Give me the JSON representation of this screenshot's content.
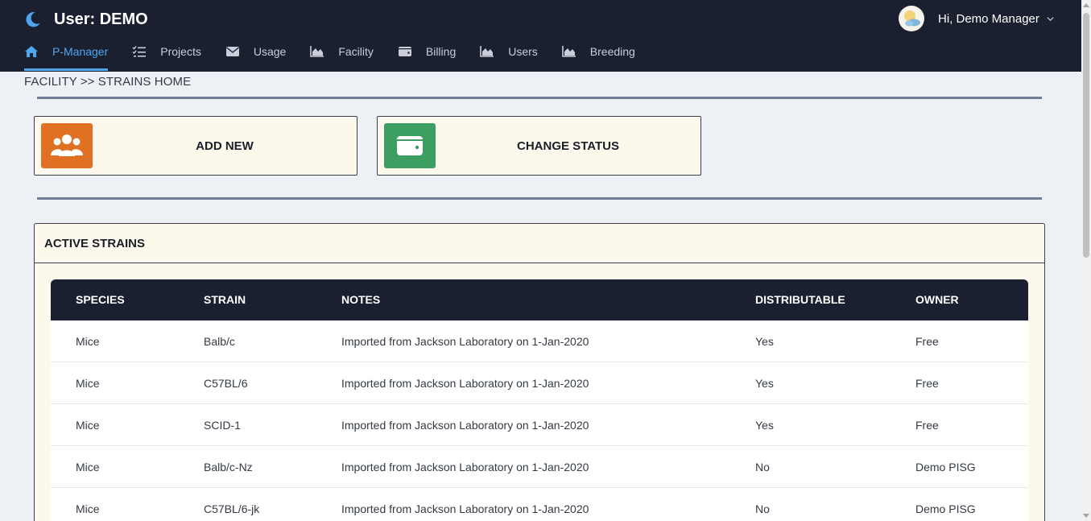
{
  "header": {
    "title": "User: DEMO",
    "greeting": "Hi, Demo Manager"
  },
  "nav": [
    {
      "label": "P-Manager",
      "icon": "home-icon",
      "active": true
    },
    {
      "label": "Projects",
      "icon": "checklist-icon"
    },
    {
      "label": "Usage",
      "icon": "envelope-icon"
    },
    {
      "label": "Facility",
      "icon": "area-chart-icon"
    },
    {
      "label": "Billing",
      "icon": "wallet-icon"
    },
    {
      "label": "Users",
      "icon": "area-chart-icon"
    },
    {
      "label": "Breeding",
      "icon": "area-chart-icon"
    }
  ],
  "breadcrumb": "FACILITY >> STRAINS HOME",
  "actions": {
    "add_new": "ADD NEW",
    "change_status": "CHANGE STATUS"
  },
  "panel": {
    "title": "ACTIVE STRAINS",
    "columns": [
      "SPECIES",
      "STRAIN",
      "NOTES",
      "DISTRIBUTABLE",
      "OWNER"
    ],
    "rows": [
      [
        "Mice",
        "Balb/c",
        "Imported from Jackson Laboratory on 1-Jan-2020",
        "Yes",
        "Free"
      ],
      [
        "Mice",
        "C57BL/6",
        "Imported from Jackson Laboratory on 1-Jan-2020",
        "Yes",
        "Free"
      ],
      [
        "Mice",
        "SCID-1",
        "Imported from Jackson Laboratory on 1-Jan-2020",
        "Yes",
        "Free"
      ],
      [
        "Mice",
        "Balb/c-Nz",
        "Imported from Jackson Laboratory on 1-Jan-2020",
        "No",
        "Demo PISG"
      ],
      [
        "Mice",
        "C57BL/6-jk",
        "Imported from Jackson Laboratory on 1-Jan-2020",
        "No",
        "Demo PISG"
      ]
    ]
  },
  "colors": {
    "topbar": "#1b2030",
    "accent": "#4ea6ef",
    "add_new_icon_bg": "#e07022",
    "change_status_icon_bg": "#3d9e62",
    "card_bg": "#fdf8ec"
  }
}
